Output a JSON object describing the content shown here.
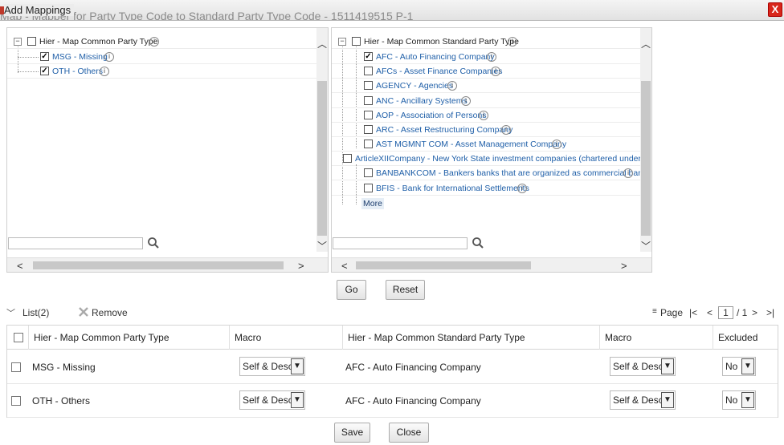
{
  "window": {
    "title": "Add Mappings",
    "background_title": "Map - Mapper for Party Type Code to Standard Party Type Code - 1511419515 P-1",
    "close_label": "X"
  },
  "left_tree": {
    "root": "Hier - Map Common Party Type",
    "items": [
      {
        "label": "MSG - Missing",
        "checked": true
      },
      {
        "label": "OTH - Others",
        "checked": true
      }
    ]
  },
  "right_tree": {
    "root": "Hier - Map Common Standard Party Type",
    "items": [
      {
        "label": "AFC - Auto Financing Company",
        "checked": true
      },
      {
        "label": "AFCs - Asset Finance Companies",
        "checked": false
      },
      {
        "label": "AGENCY - Agencies",
        "checked": false
      },
      {
        "label": "ANC - Ancillary Systems",
        "checked": false
      },
      {
        "label": "AOP - Association of Persons",
        "checked": false
      },
      {
        "label": "ARC - Asset Restructuring Company",
        "checked": false
      },
      {
        "label": "AST MGMNT COM - Asset Management Company",
        "checked": false
      },
      {
        "label": "ArticleXIICompany - New York State investment companies (chartered under Article XII",
        "checked": false
      },
      {
        "label": "BANBANKCOM - Bankers banks that are organized as commercial banks",
        "checked": false
      },
      {
        "label": "BFIS - Bank for International Settlements",
        "checked": false
      }
    ],
    "more_label": "More"
  },
  "buttons": {
    "go": "Go",
    "reset": "Reset",
    "save": "Save",
    "close": "Close"
  },
  "list": {
    "title": "List(2)",
    "remove_label": "Remove",
    "page_label": "Page",
    "page_current": "1",
    "page_total": "/ 1"
  },
  "grid": {
    "headers": [
      "Hier - Map Common Party Type",
      "Macro",
      "Hier - Map Common Standard Party Type",
      "Macro",
      "Excluded"
    ],
    "rows": [
      {
        "party_type": "MSG - Missing",
        "macro1": "Self & Desc",
        "standard_type": "AFC - Auto Financing Company",
        "macro2": "Self & Desc",
        "excluded": "No"
      },
      {
        "party_type": "OTH - Others",
        "macro1": "Self & Desc",
        "standard_type": "AFC - Auto Financing Company",
        "macro2": "Self & Desc",
        "excluded": "No"
      }
    ]
  },
  "icons": {
    "info": "info-icon",
    "search": "search-icon",
    "remove": "remove-x-icon",
    "collapse": "minus-icon"
  }
}
